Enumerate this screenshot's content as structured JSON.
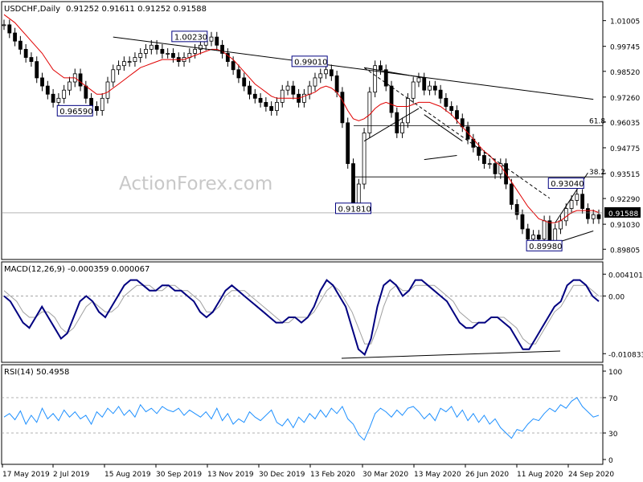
{
  "header": {
    "symbol": "USDCHF,Daily",
    "ohlc": "0.91252 0.91611 0.91252 0.91588"
  },
  "watermark": "ActionForex.com",
  "colors": {
    "candle": "#000000",
    "ma": "#e00000",
    "macd": "#000080",
    "signal": "#a0a0a0",
    "rsi": "#1e90ff",
    "label_border": "#000080"
  },
  "chart_data": [
    {
      "type": "candlestick",
      "title": "USDCHF,Daily 0.91252 0.91611 0.91252 0.91588",
      "ylim": [
        0.895,
        1.017
      ],
      "y_ticks": [
        "1.01005",
        "0.99745",
        "0.98520",
        "0.97260",
        "0.96035",
        "0.94775",
        "0.93515",
        "0.92290",
        "0.91030",
        "0.89805"
      ],
      "y_tick_values": [
        1.01005,
        0.99745,
        0.9852,
        0.9726,
        0.96035,
        0.94775,
        0.93515,
        0.9229,
        0.9103,
        0.89805
      ],
      "last_price": "0.91588",
      "x_ticks": [
        "17 May 2019",
        "2 Jul 2019",
        "15 Aug 2019",
        "30 Sep 2019",
        "13 Nov 2019",
        "30 Dec 2019",
        "13 Feb 2020",
        "30 Mar 2020",
        "13 May 2020",
        "26 Jun 2020",
        "11 Aug 2020",
        "24 Sep 2020"
      ],
      "close_series": [
        1.008,
        1.004,
        1.0,
        0.996,
        0.992,
        0.99,
        0.982,
        0.978,
        0.974,
        0.97,
        0.972,
        0.976,
        0.98,
        0.984,
        0.978,
        0.972,
        0.968,
        0.966,
        0.972,
        0.98,
        0.986,
        0.988,
        0.99,
        0.99,
        0.992,
        0.994,
        0.996,
        0.998,
        0.996,
        0.994,
        0.994,
        0.992,
        0.99,
        0.992,
        0.994,
        0.996,
        0.998,
        1.0,
        1.002,
        0.998,
        0.994,
        0.99,
        0.986,
        0.982,
        0.978,
        0.974,
        0.972,
        0.97,
        0.968,
        0.966,
        0.97,
        0.976,
        0.978,
        0.974,
        0.97,
        0.974,
        0.978,
        0.982,
        0.984,
        0.986,
        0.983,
        0.975,
        0.96,
        0.94,
        0.92,
        0.93,
        0.955,
        0.975,
        0.988,
        0.986,
        0.978,
        0.965,
        0.955,
        0.96,
        0.972,
        0.98,
        0.982,
        0.976,
        0.978,
        0.976,
        0.972,
        0.968,
        0.966,
        0.962,
        0.958,
        0.952,
        0.948,
        0.944,
        0.94,
        0.94,
        0.935,
        0.94,
        0.93,
        0.92,
        0.915,
        0.908,
        0.903,
        0.905,
        0.903,
        0.912,
        0.9,
        0.908,
        0.912,
        0.918,
        0.922,
        0.925,
        0.918,
        0.913,
        0.915,
        0.913
      ],
      "ma_series": [
        1.013,
        1.011,
        1.009,
        1.006,
        1.003,
        1.0,
        0.997,
        0.994,
        0.99,
        0.986,
        0.984,
        0.982,
        0.982,
        0.982,
        0.98,
        0.978,
        0.976,
        0.974,
        0.974,
        0.975,
        0.977,
        0.979,
        0.981,
        0.983,
        0.985,
        0.987,
        0.988,
        0.989,
        0.99,
        0.991,
        0.991,
        0.991,
        0.991,
        0.991,
        0.992,
        0.993,
        0.994,
        0.995,
        0.996,
        0.996,
        0.995,
        0.993,
        0.991,
        0.988,
        0.985,
        0.982,
        0.979,
        0.977,
        0.975,
        0.973,
        0.972,
        0.972,
        0.972,
        0.972,
        0.972,
        0.973,
        0.974,
        0.975,
        0.977,
        0.978,
        0.977,
        0.975,
        0.971,
        0.966,
        0.962,
        0.961,
        0.962,
        0.964,
        0.967,
        0.969,
        0.97,
        0.969,
        0.968,
        0.968,
        0.968,
        0.969,
        0.97,
        0.97,
        0.97,
        0.969,
        0.968,
        0.966,
        0.964,
        0.961,
        0.958,
        0.955,
        0.952,
        0.949,
        0.946,
        0.944,
        0.941,
        0.939,
        0.935,
        0.931,
        0.927,
        0.923,
        0.919,
        0.916,
        0.913,
        0.912,
        0.911,
        0.911,
        0.912,
        0.914,
        0.916,
        0.917,
        0.917,
        0.917,
        0.917,
        0.916
      ],
      "annotations": [
        {
          "text": "1.00230",
          "x_index": 34,
          "y": 1.0023
        },
        {
          "text": "0.99010",
          "x_index": 56,
          "y": 0.9901
        },
        {
          "text": "0.96590",
          "x_index": 13,
          "y": 0.9659
        },
        {
          "text": "0.91810",
          "x_index": 64,
          "y": 0.9181
        },
        {
          "text": "0.93040",
          "x_index": 103,
          "y": 0.9304
        },
        {
          "text": "0.89980",
          "x_index": 99,
          "y": 0.8998
        }
      ],
      "fib_levels": [
        {
          "label": "61.8",
          "y": 0.9585
        },
        {
          "label": "38.2",
          "y": 0.9335
        }
      ]
    },
    {
      "type": "line",
      "name": "MACD(12,26,9) -0.000359 0.000067",
      "ylim": [
        -0.012,
        0.0055
      ],
      "y_ticks": [
        "0.004101",
        "0.00",
        "-0.010833"
      ],
      "y_tick_values": [
        0.004101,
        0.0,
        -0.010833
      ],
      "macd_series": [
        0.0,
        -0.001,
        -0.003,
        -0.005,
        -0.006,
        -0.004,
        -0.002,
        -0.004,
        -0.006,
        -0.008,
        -0.007,
        -0.004,
        -0.001,
        0.0,
        -0.001,
        -0.003,
        -0.004,
        -0.002,
        0.0,
        0.002,
        0.003,
        0.003,
        0.002,
        0.001,
        0.001,
        0.002,
        0.002,
        0.001,
        0.001,
        0.0,
        -0.001,
        -0.003,
        -0.004,
        -0.003,
        -0.001,
        0.001,
        0.002,
        0.001,
        0.0,
        -0.001,
        -0.002,
        -0.003,
        -0.004,
        -0.005,
        -0.005,
        -0.004,
        -0.004,
        -0.005,
        -0.004,
        -0.002,
        0.001,
        0.003,
        0.002,
        0.0,
        -0.002,
        -0.006,
        -0.01,
        -0.011,
        -0.008,
        -0.002,
        0.002,
        0.003,
        0.002,
        0.0,
        0.001,
        0.003,
        0.003,
        0.002,
        0.001,
        0.0,
        -0.001,
        -0.003,
        -0.005,
        -0.006,
        -0.006,
        -0.005,
        -0.005,
        -0.004,
        -0.004,
        -0.005,
        -0.006,
        -0.008,
        -0.01,
        -0.01,
        -0.008,
        -0.006,
        -0.004,
        -0.002,
        -0.001,
        0.002,
        0.003,
        0.003,
        0.002,
        0.0,
        -0.001
      ],
      "signal_series": [
        0.001,
        0.0,
        -0.001,
        -0.003,
        -0.004,
        -0.004,
        -0.003,
        -0.003,
        -0.004,
        -0.006,
        -0.007,
        -0.006,
        -0.004,
        -0.002,
        -0.001,
        -0.002,
        -0.003,
        -0.003,
        -0.002,
        0.0,
        0.001,
        0.002,
        0.002,
        0.002,
        0.001,
        0.001,
        0.002,
        0.002,
        0.001,
        0.001,
        0.0,
        -0.001,
        -0.003,
        -0.003,
        -0.002,
        0.0,
        0.001,
        0.001,
        0.001,
        0.0,
        -0.001,
        -0.002,
        -0.003,
        -0.004,
        -0.005,
        -0.005,
        -0.004,
        -0.004,
        -0.004,
        -0.003,
        -0.001,
        0.001,
        0.002,
        0.001,
        -0.001,
        -0.003,
        -0.006,
        -0.009,
        -0.009,
        -0.006,
        -0.002,
        0.001,
        0.002,
        0.001,
        0.001,
        0.002,
        0.002,
        0.002,
        0.002,
        0.001,
        0.0,
        -0.001,
        -0.003,
        -0.004,
        -0.005,
        -0.005,
        -0.005,
        -0.004,
        -0.004,
        -0.004,
        -0.005,
        -0.006,
        -0.008,
        -0.009,
        -0.009,
        -0.007,
        -0.005,
        -0.003,
        -0.002,
        0.0,
        0.002,
        0.002,
        0.002,
        0.001,
        0.0
      ]
    },
    {
      "type": "line",
      "name": "RSI(14) 50.4958",
      "ylim": [
        0,
        100
      ],
      "y_ticks": [
        "100",
        "70",
        "30",
        "0"
      ],
      "y_tick_values": [
        100,
        70,
        30,
        0
      ],
      "rsi_series": [
        48,
        52,
        45,
        55,
        40,
        50,
        42,
        58,
        46,
        52,
        44,
        56,
        48,
        54,
        46,
        50,
        40,
        54,
        48,
        58,
        52,
        60,
        50,
        56,
        48,
        62,
        54,
        58,
        52,
        60,
        56,
        54,
        58,
        50,
        56,
        52,
        48,
        54,
        46,
        58,
        44,
        52,
        40,
        46,
        42,
        54,
        48,
        44,
        50,
        56,
        42,
        38,
        46,
        36,
        48,
        42,
        52,
        46,
        56,
        48,
        58,
        52,
        60,
        46,
        40,
        28,
        22,
        36,
        52,
        58,
        54,
        48,
        56,
        50,
        58,
        60,
        54,
        46,
        52,
        44,
        58,
        54,
        60,
        48,
        56,
        44,
        52,
        42,
        50,
        40,
        46,
        36,
        30,
        24,
        34,
        32,
        40,
        46,
        44,
        52,
        58,
        54,
        62,
        58,
        66,
        70,
        60,
        54,
        48,
        50
      ]
    }
  ]
}
